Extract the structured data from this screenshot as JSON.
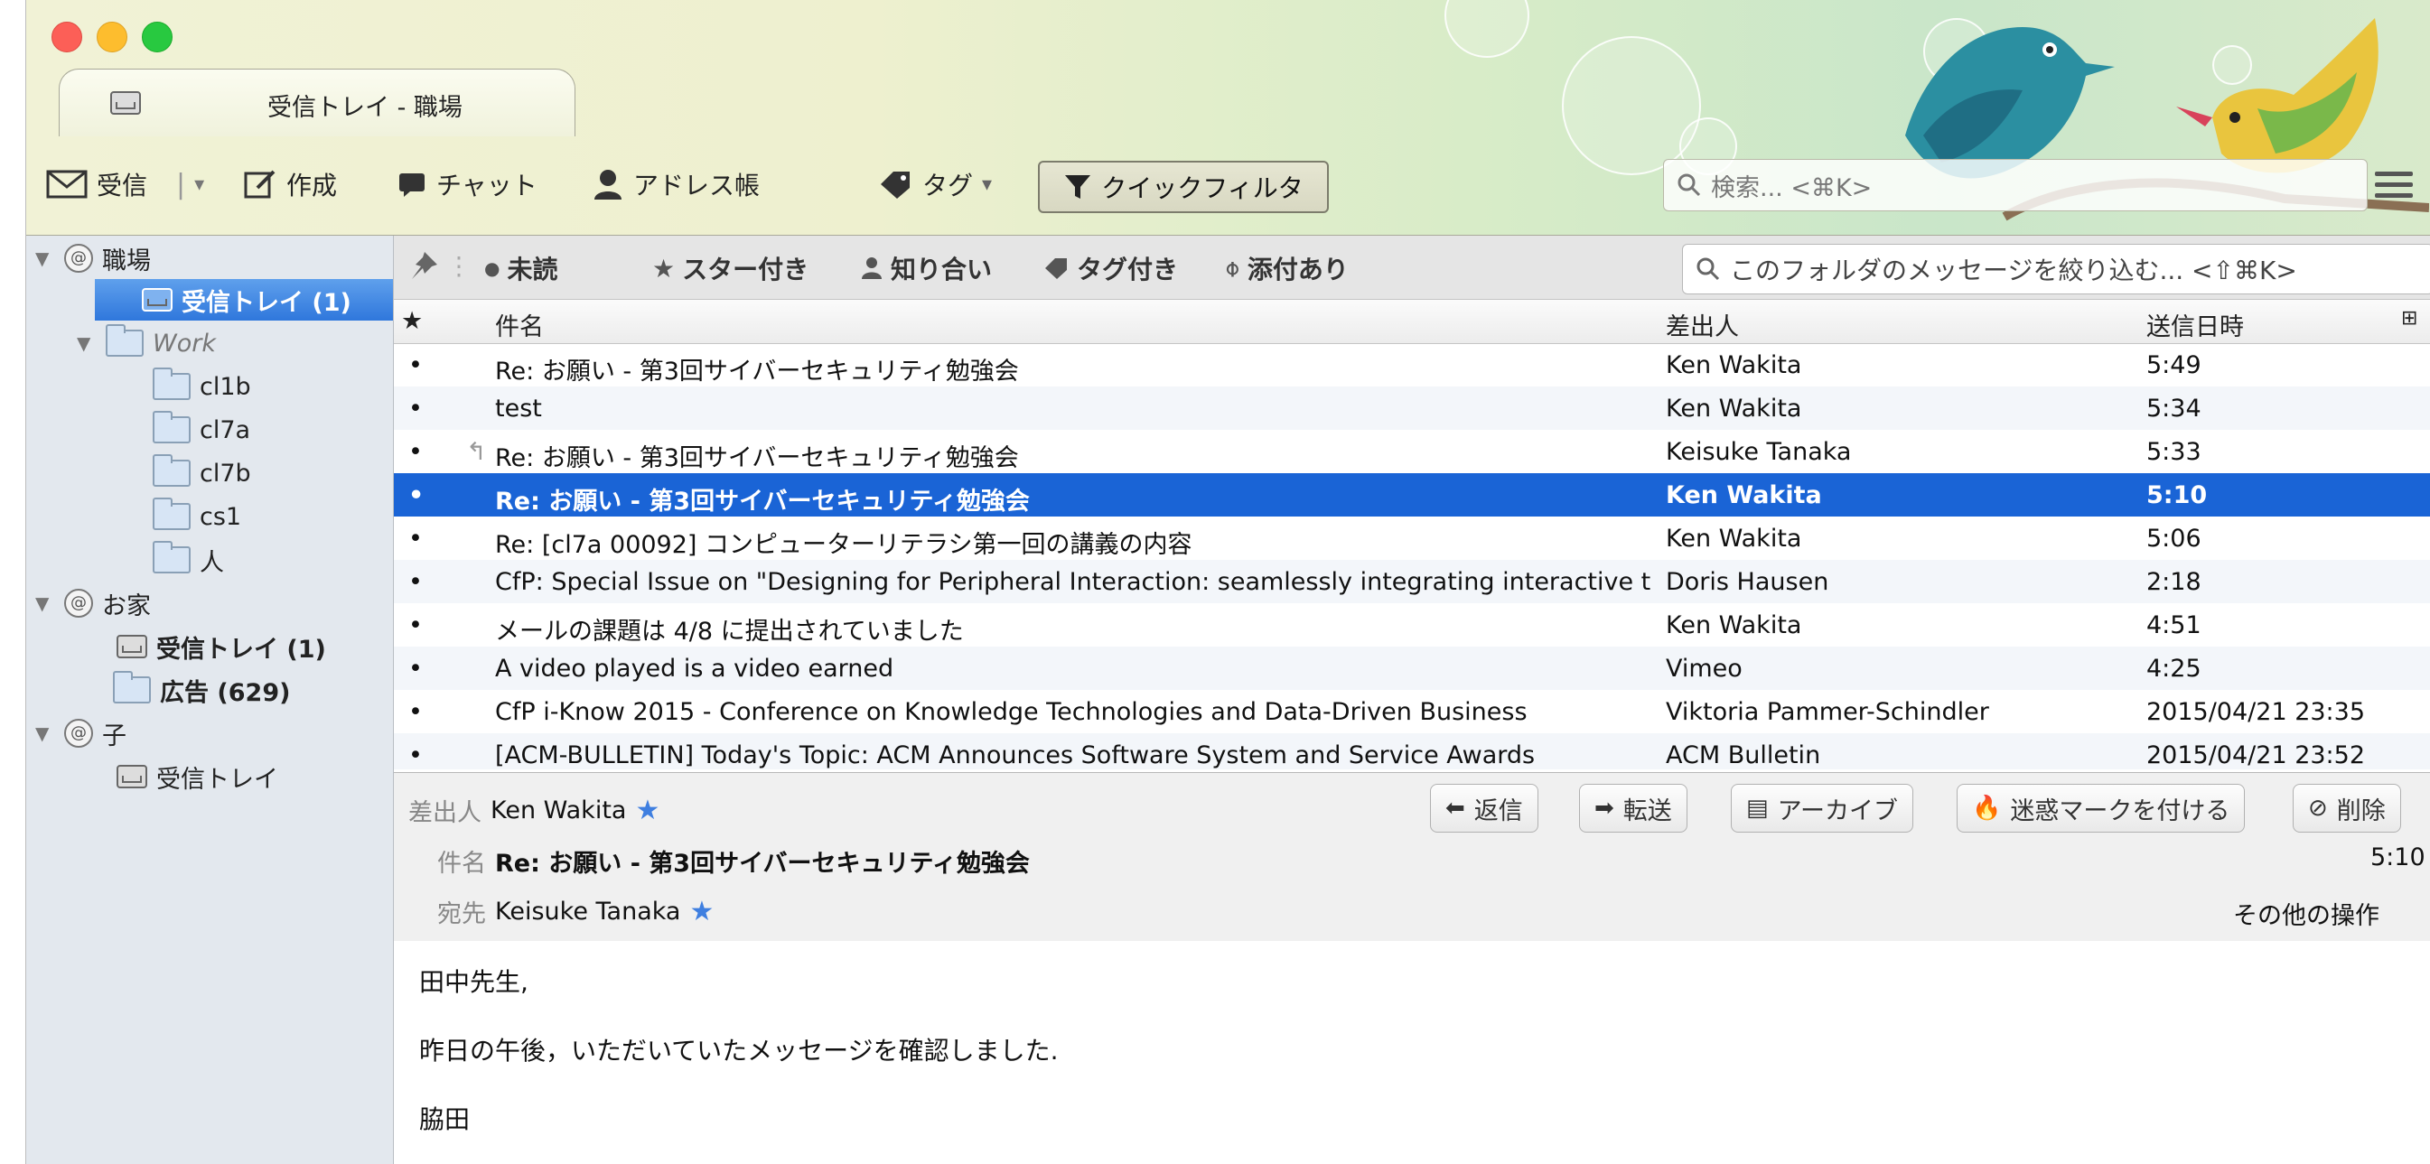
{
  "window": {
    "tab_title": "受信トレイ - 職場"
  },
  "toolbar": {
    "get": "受信",
    "write": "作成",
    "chat": "チャット",
    "addressbook": "アドレス帳",
    "tag": "タグ",
    "quickfilter": "クイックフィルタ",
    "search_placeholder": "検索... <⌘K>"
  },
  "sidebar": {
    "acct1": "職場",
    "acct1_inbox": "受信トレイ (1)",
    "work": "Work",
    "f_cl1b": "cl1b",
    "f_cl7a": "cl7a",
    "f_cl7b": "cl7b",
    "f_cs1": "cs1",
    "f_hito": "人",
    "acct2": "お家",
    "acct2_inbox": "受信トレイ (1)",
    "acct2_ads": "広告 (629)",
    "acct3": "子",
    "acct3_inbox": "受信トレイ"
  },
  "filters": {
    "unread": "未読",
    "starred": "スター付き",
    "contacts": "知り合い",
    "tagged": "タグ付き",
    "attachment": "添付あり",
    "folder_filter_placeholder": "このフォルダのメッセージを絞り込む... <⇧⌘K>"
  },
  "columns": {
    "star": "★",
    "subject": "件名",
    "from": "差出人",
    "date": "送信日時"
  },
  "messages": [
    {
      "subject": "Re: お願い - 第3回サイバーセキュリティ勉強会",
      "from": "Ken Wakita",
      "date": "5:49"
    },
    {
      "subject": "test",
      "from": "Ken Wakita",
      "date": "5:34"
    },
    {
      "subject": "Re: お願い - 第3回サイバーセキュリティ勉強会",
      "from": "Keisuke Tanaka",
      "date": "5:33"
    },
    {
      "subject": "Re: お願い - 第3回サイバーセキュリティ勉強会",
      "from": "Ken Wakita",
      "date": "5:10"
    },
    {
      "subject": "Re: [cl7a 00092] コンピューターリテラシ第一回の講義の内容",
      "from": "Ken Wakita",
      "date": "5:06"
    },
    {
      "subject": "CfP: Special Issue on \"Designing for Peripheral Interaction: seamlessly integrating interactive te…",
      "from": "Doris Hausen",
      "date": "2:18"
    },
    {
      "subject": "メールの課題は 4/8 に提出されていました",
      "from": "Ken Wakita",
      "date": "4:51"
    },
    {
      "subject": "A video played is a video earned",
      "from": "Vimeo",
      "date": "4:25"
    },
    {
      "subject": "CfP i-Know 2015 - Conference on Knowledge Technologies and Data-Driven Business",
      "from": "Viktoria Pammer-Schindler",
      "date": "2015/04/21 23:35"
    },
    {
      "subject": "[ACM-BULLETIN] Today's Topic: ACM Announces Software System and Service Awards",
      "from": "ACM Bulletin",
      "date": "2015/04/21 23:52"
    }
  ],
  "header": {
    "from_label": "差出人",
    "from": "Ken Wakita",
    "subject_label": "件名",
    "subject": "Re: お願い - 第3回サイバーセキュリティ勉強会",
    "to_label": "宛先",
    "to": "Keisuke Tanaka",
    "time": "5:10",
    "other_actions": "その他の操作",
    "reply": "返信",
    "forward": "転送",
    "archive": "アーカイブ",
    "junk": "迷惑マークを付ける",
    "delete": "削除"
  },
  "body": {
    "line1": "田中先生,",
    "line2": "昨日の午後，いただいていたメッセージを確認しました.",
    "line3": "脇田"
  }
}
